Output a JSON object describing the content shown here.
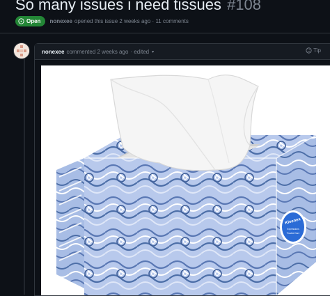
{
  "issue": {
    "title": "So many issues i need tissues",
    "number": "#108",
    "state": "Open",
    "author": "nonexee",
    "opened_text": "opened this issue 2 weeks ago · 11 comments"
  },
  "comment": {
    "author": "nonexee",
    "action_text": "commented 2 weeks ago",
    "edited_text": "· edited",
    "caret": "▾",
    "reaction_label": "Tip"
  },
  "image": {
    "brand_logo_text": "Kleenex",
    "logo_sub1": "Expressions",
    "logo_sub2": "Trusted Care"
  },
  "colors": {
    "bg": "#0d1117",
    "open_badge": "#238636",
    "box_blue": "#a9bde6",
    "swirl_dark": "#4d6fa8",
    "logo_blue": "#2b6bd6"
  }
}
